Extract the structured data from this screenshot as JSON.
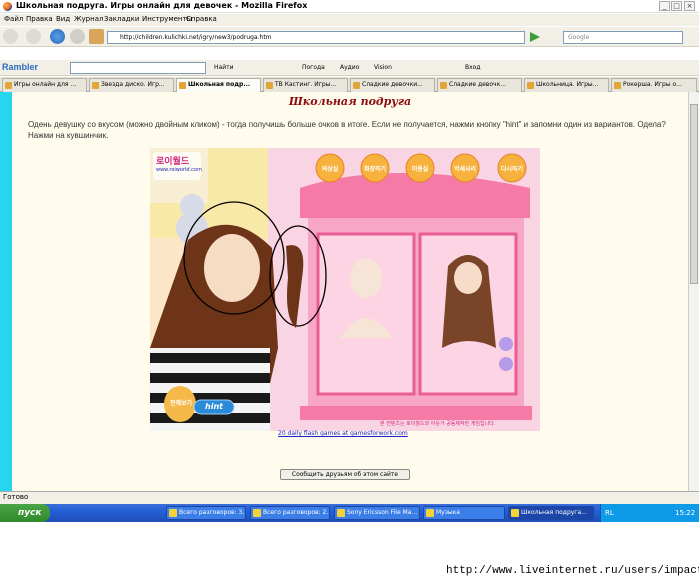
{
  "window": {
    "title": "Школьная подруга. Игры онлайн для девочек - Mozilla Firefox"
  },
  "menu": [
    "Файл",
    "Правка",
    "Вид",
    "Журнал",
    "Закладки",
    "Инструменты",
    "Справка"
  ],
  "address": {
    "url": "http://children.kulichki.net/igry/new3/podruga.htm",
    "search_placeholder": "Google"
  },
  "rambler": {
    "logo": "Rambler",
    "find": "Найти",
    "weather": "Погода",
    "audio": "Аудио",
    "vision": "Vision",
    "login": "Вход"
  },
  "tabs": [
    {
      "label": "Игры онлайн для ..."
    },
    {
      "label": "Звезда диско. Игр..."
    },
    {
      "label": "Школьная подр..."
    },
    {
      "label": "ТВ Кастинг. Игры..."
    },
    {
      "label": "Сладкие девочки..."
    },
    {
      "label": "Сладкие девочк..."
    },
    {
      "label": "Школьница. Игры..."
    },
    {
      "label": "Рокерша. Игры о..."
    }
  ],
  "page": {
    "title": "Школьная подруга",
    "description": "Одень девушку со вкусом (можно двойным кликом) - тогда получишь больше очков в итоге. Если не получается, нажми кнопку \"hint\" и запомни один из вариантов. Одела? Нажми на кувшинчик.",
    "footer_link": "20 daily flash games at gamesforwork.com",
    "share_button": "Сообщить друзьям об этом сайте"
  },
  "game": {
    "logo": "로이월드",
    "logo_sub": "www.roiworld.com",
    "menu_buttons": [
      "의상실",
      "화장하기",
      "미용실",
      "악세사리",
      "다시하기"
    ],
    "hint_button": "hint",
    "reset_label": "전체보기",
    "bottom_text": "본 컨텐츠는 로이월드와 아웃가 공동제작한 게임입니다."
  },
  "status": {
    "text": "Готово"
  },
  "taskbar": {
    "start": "пуск",
    "items": [
      "Всего разговоров: 3...",
      "Всего разговоров: 2...",
      "Sony Ericsson File Ma...",
      "Музыка",
      "Школьная подруга..."
    ],
    "lang": "RL",
    "time": "15:22"
  },
  "watermark": "http://www.liveinternet.ru/users/impacto/",
  "colors": {
    "accent": "#27d6ee",
    "title": "#8a0c0c",
    "page_bg": "#fffcee"
  }
}
